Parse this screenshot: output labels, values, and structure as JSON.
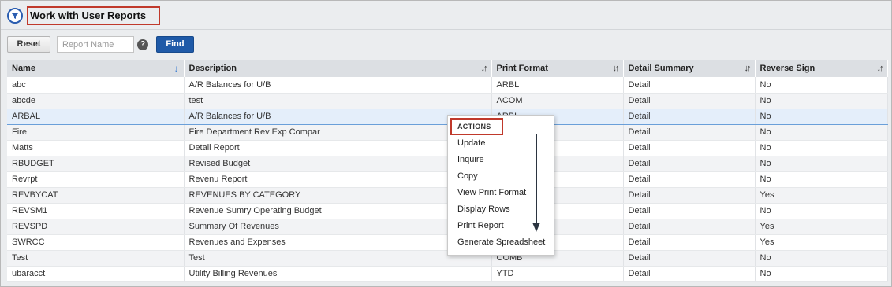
{
  "page": {
    "title": "Work with User Reports",
    "filter_icon": "filter-funnel-icon"
  },
  "toolbar": {
    "reset_label": "Reset",
    "search_placeholder": "Report Name",
    "search_value": "",
    "help_label": "?",
    "find_label": "Find"
  },
  "table": {
    "columns": [
      "Name",
      "Description",
      "Print Format",
      "Detail Summary",
      "Reverse Sign"
    ],
    "sorted_column": "Name",
    "rows": [
      {
        "name": "abc",
        "description": "A/R Balances for U/B",
        "print_format": "ARBL",
        "detail_summary": "Detail",
        "reverse_sign": "No"
      },
      {
        "name": "abcde",
        "description": "test",
        "print_format": "ACOM",
        "detail_summary": "Detail",
        "reverse_sign": "No"
      },
      {
        "name": "ARBAL",
        "description": "A/R Balances for U/B",
        "print_format": "ARBL",
        "detail_summary": "Detail",
        "reverse_sign": "No"
      },
      {
        "name": "Fire",
        "description": "Fire Department Rev Exp Compar",
        "print_format": "",
        "detail_summary": "Detail",
        "reverse_sign": "No"
      },
      {
        "name": "Matts",
        "description": "Detail Report",
        "print_format": "",
        "detail_summary": "Detail",
        "reverse_sign": "No"
      },
      {
        "name": "RBUDGET",
        "description": "Revised Budget",
        "print_format": "",
        "detail_summary": "Detail",
        "reverse_sign": "No"
      },
      {
        "name": "Revrpt",
        "description": "Revenu Report",
        "print_format": "",
        "detail_summary": "Detail",
        "reverse_sign": "No"
      },
      {
        "name": "REVBYCAT",
        "description": "REVENUES BY CATEGORY",
        "print_format": "",
        "detail_summary": "Detail",
        "reverse_sign": "Yes"
      },
      {
        "name": "REVSM1",
        "description": "Revenue Sumry Operating Budget",
        "print_format": "",
        "detail_summary": "Detail",
        "reverse_sign": "No"
      },
      {
        "name": "REVSPD",
        "description": "Summary Of Revenues",
        "print_format": "",
        "detail_summary": "Detail",
        "reverse_sign": "Yes"
      },
      {
        "name": "SWRCC",
        "description": "Revenues and Expenses",
        "print_format": "",
        "detail_summary": "Detail",
        "reverse_sign": "Yes"
      },
      {
        "name": "Test",
        "description": "Test",
        "print_format": "COMB",
        "detail_summary": "Detail",
        "reverse_sign": "No"
      },
      {
        "name": "ubaracct",
        "description": "Utility Billing Revenues",
        "print_format": "YTD",
        "detail_summary": "Detail",
        "reverse_sign": "No"
      }
    ],
    "selected_row": "ARBAL"
  },
  "actions_menu": {
    "header": "ACTIONS",
    "items": [
      "Update",
      "Inquire",
      "Copy",
      "View Print Format",
      "Display Rows",
      "Print Report",
      "Generate Spreadsheet"
    ]
  },
  "colors": {
    "find_button": "#1f5aa8",
    "highlight_box": "#c0392b",
    "selected_row": "#e4eefa",
    "header_bg": "#dcdfe3"
  }
}
